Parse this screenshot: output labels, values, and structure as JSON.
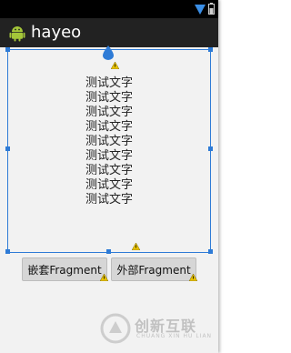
{
  "app": {
    "title": "hayeo"
  },
  "status_bar": {
    "icons": [
      "wifi-icon",
      "battery-icon"
    ]
  },
  "fragment": {
    "lines": [
      "测试文字",
      "测试文字",
      "测试文字",
      "测试文字",
      "测试文字",
      "测试文字",
      "测试文字",
      "测试文字",
      "测试文字"
    ]
  },
  "buttons": {
    "nested_label": "嵌套Fragment",
    "external_label": "外部Fragment"
  },
  "watermark": {
    "cn": "创新互联",
    "en": "CHUANG XIN HU LIAN"
  },
  "colors": {
    "selection": "#2e7bd6",
    "warning": "#e8c200",
    "action_bar": "#222222",
    "status_bar": "#000000"
  }
}
